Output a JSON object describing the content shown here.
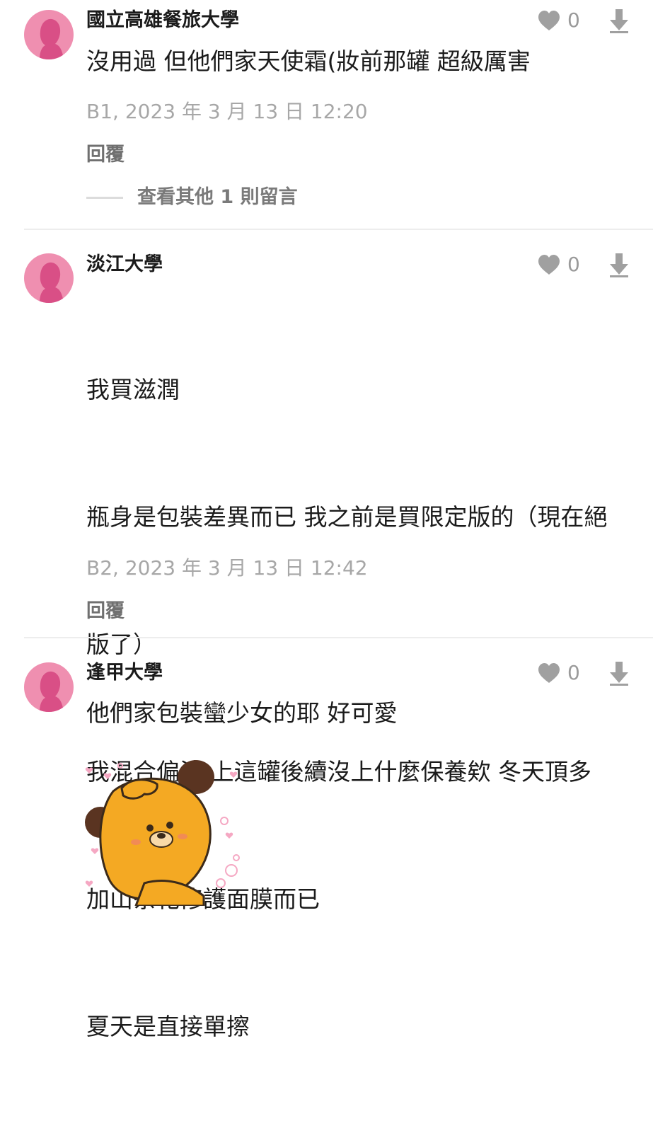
{
  "colors": {
    "avatar_bg": "#ef8fb0",
    "avatar_fg": "#d94f86",
    "muted_text": "#a7a7a7",
    "icon_gray": "#a0a0a0"
  },
  "comments": [
    {
      "author": "國立高雄餐旅大學",
      "likes": "0",
      "text": "沒用過 但他們家天使霜(妝前那罐 超級厲害",
      "meta": "B1, 2023 年 3 月 13 日 12:20",
      "reply_label": "回覆",
      "more_replies": "查看其他 1 則留言"
    },
    {
      "author": "淡江大學",
      "likes": "0",
      "lines": [
        "我買滋潤",
        "瓶身是包裝差異而已 我之前是買限定版的（現在絕",
        "版了）",
        "我混合偏油 上這罐後續沒上什麼保養欸 冬天頂多",
        "加山茶花修護面膜而已",
        "夏天是直接單擦"
      ],
      "meta": "B2, 2023 年 3 月 13 日 12:42",
      "reply_label": "回覆"
    },
    {
      "author": "逢甲大學",
      "likes": "0",
      "text": "他們家包裝蠻少女的耶 好可愛",
      "sticker": "bear-sticker"
    }
  ],
  "icons": {
    "like": "heart-icon",
    "dislike": "down-arrow-icon",
    "avatar": "female-avatar-icon"
  }
}
